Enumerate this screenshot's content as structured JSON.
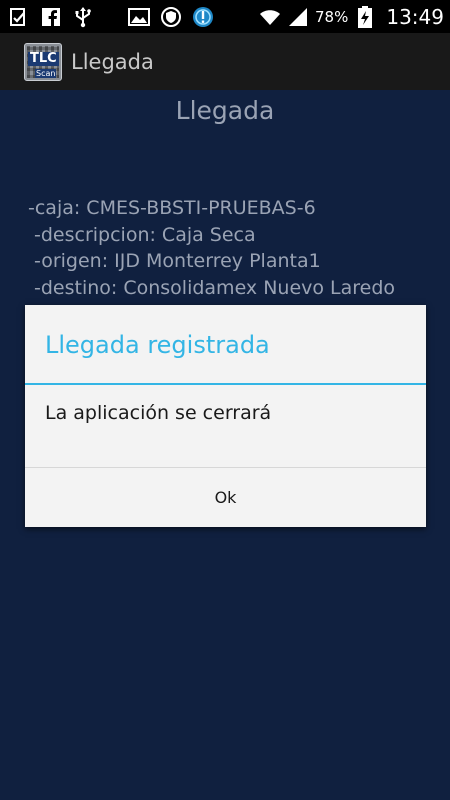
{
  "status_bar": {
    "left_icons": [
      "checklist-icon",
      "facebook-icon",
      "usb-icon",
      "image-icon",
      "shield-icon",
      "alert-icon"
    ],
    "right_icons": [
      "wifi-icon",
      "signal-icon",
      "battery-charging-icon"
    ],
    "battery_percent": "78%",
    "time": "13:49"
  },
  "action_bar": {
    "logo_text": "TLC",
    "logo_subtext": "Scan",
    "title": "Llegada"
  },
  "main": {
    "heading": "Llegada",
    "info_lines": [
      "-caja: CMES-BBSTI-PRUEBAS-6",
      "-descripcion: Caja Seca",
      "-origen: IJD Monterrey Planta1",
      "-destino: Consolidamex Nuevo Laredo"
    ]
  },
  "dialog": {
    "title": "Llegada registrada",
    "message": "La aplicación se cerrará",
    "ok_label": "Ok"
  },
  "colors": {
    "background": "#10203f",
    "dialog_accent": "#33b5e5",
    "dialog_bg": "#f3f3f3"
  }
}
